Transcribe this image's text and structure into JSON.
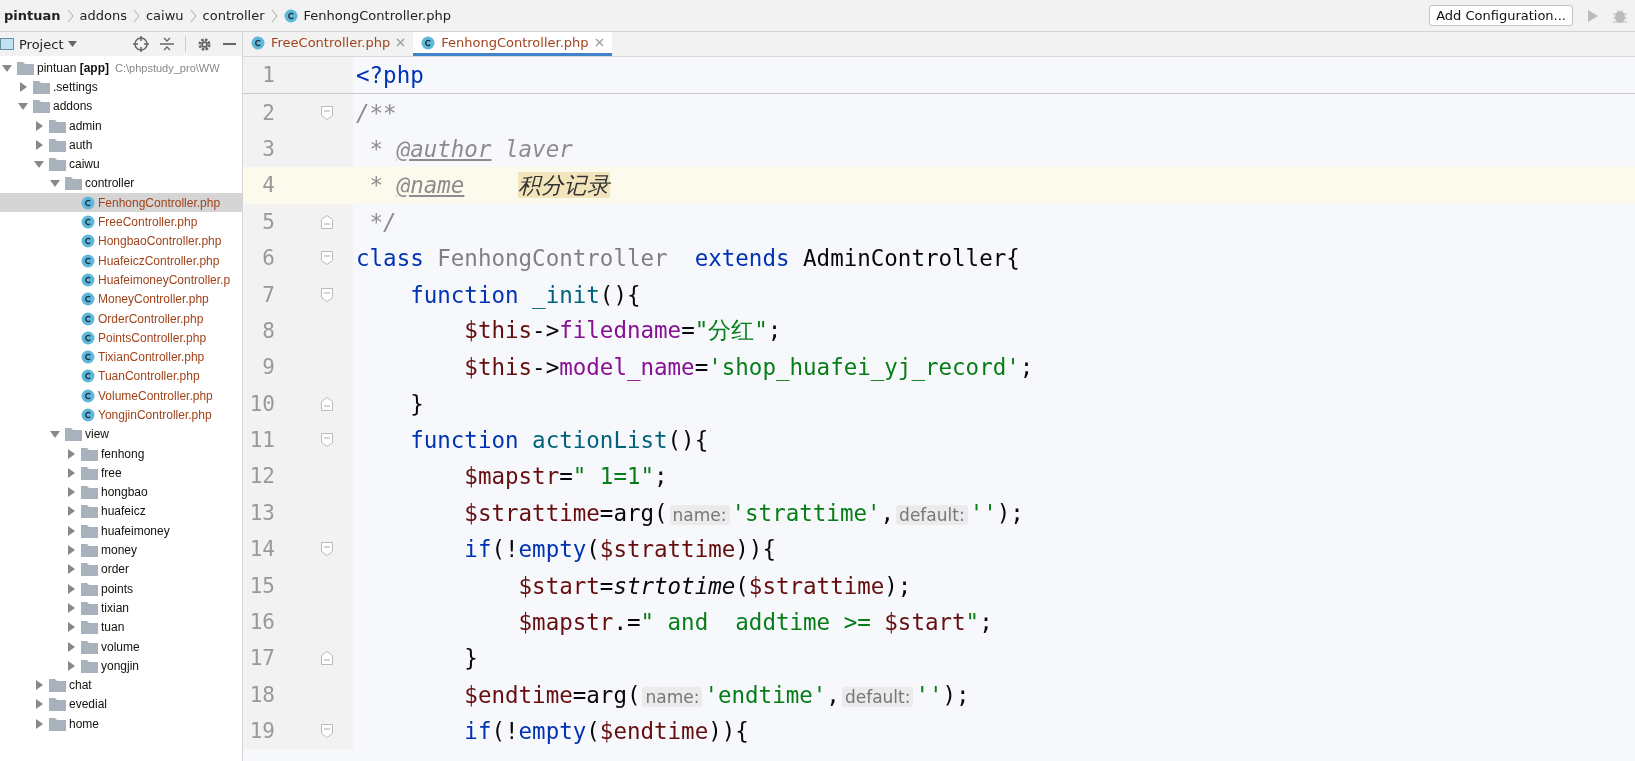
{
  "breadcrumbs": [
    {
      "label": "pintuan",
      "kind": "root"
    },
    {
      "label": "addons",
      "kind": "folder"
    },
    {
      "label": "caiwu",
      "kind": "folder"
    },
    {
      "label": "controller",
      "kind": "folder"
    },
    {
      "label": "FenhongController.php",
      "kind": "php"
    }
  ],
  "run_config": {
    "label": "Add Configuration..."
  },
  "project_panel": {
    "title": "Project"
  },
  "tree": [
    {
      "label": "pintuan **[app]**",
      "path": "C:\\phpstudy_pro\\WW",
      "kind": "folder",
      "expanded": true,
      "selected": false,
      "children": [
        {
          "label": ".settings",
          "kind": "folder",
          "expanded": false,
          "selected": false
        },
        {
          "label": "addons",
          "kind": "folder",
          "expanded": true,
          "selected": false,
          "children": [
            {
              "label": "admin",
              "kind": "folder",
              "expanded": false,
              "selected": false
            },
            {
              "label": "auth",
              "kind": "folder",
              "expanded": false,
              "selected": false
            },
            {
              "label": "caiwu",
              "kind": "folder",
              "expanded": true,
              "selected": false,
              "children": [
                {
                  "label": "controller",
                  "kind": "folder",
                  "expanded": true,
                  "selected": false,
                  "children": [
                    {
                      "label": "FenhongController.php",
                      "kind": "php",
                      "selected": true
                    },
                    {
                      "label": "FreeController.php",
                      "kind": "php",
                      "selected": false
                    },
                    {
                      "label": "HongbaoController.php",
                      "kind": "php",
                      "selected": false
                    },
                    {
                      "label": "HuafeiczController.php",
                      "kind": "php",
                      "selected": false
                    },
                    {
                      "label": "HuafeimoneyController.p",
                      "kind": "php",
                      "selected": false
                    },
                    {
                      "label": "MoneyController.php",
                      "kind": "php",
                      "selected": false
                    },
                    {
                      "label": "OrderController.php",
                      "kind": "php",
                      "selected": false
                    },
                    {
                      "label": "PointsController.php",
                      "kind": "php",
                      "selected": false
                    },
                    {
                      "label": "TixianController.php",
                      "kind": "php",
                      "selected": false
                    },
                    {
                      "label": "TuanController.php",
                      "kind": "php",
                      "selected": false
                    },
                    {
                      "label": "VolumeController.php",
                      "kind": "php",
                      "selected": false
                    },
                    {
                      "label": "YongjinController.php",
                      "kind": "php",
                      "selected": false
                    }
                  ]
                },
                {
                  "label": "view",
                  "kind": "folder",
                  "expanded": true,
                  "selected": false,
                  "children": [
                    {
                      "label": "fenhong",
                      "kind": "folder",
                      "expanded": false,
                      "selected": false
                    },
                    {
                      "label": "free",
                      "kind": "folder",
                      "expanded": false,
                      "selected": false
                    },
                    {
                      "label": "hongbao",
                      "kind": "folder",
                      "expanded": false,
                      "selected": false
                    },
                    {
                      "label": "huafeicz",
                      "kind": "folder",
                      "expanded": false,
                      "selected": false
                    },
                    {
                      "label": "huafeimoney",
                      "kind": "folder",
                      "expanded": false,
                      "selected": false
                    },
                    {
                      "label": "money",
                      "kind": "folder",
                      "expanded": false,
                      "selected": false
                    },
                    {
                      "label": "order",
                      "kind": "folder",
                      "expanded": false,
                      "selected": false
                    },
                    {
                      "label": "points",
                      "kind": "folder",
                      "expanded": false,
                      "selected": false
                    },
                    {
                      "label": "tixian",
                      "kind": "folder",
                      "expanded": false,
                      "selected": false
                    },
                    {
                      "label": "tuan",
                      "kind": "folder",
                      "expanded": false,
                      "selected": false
                    },
                    {
                      "label": "volume",
                      "kind": "folder",
                      "expanded": false,
                      "selected": false
                    },
                    {
                      "label": "yongjin",
                      "kind": "folder",
                      "expanded": false,
                      "selected": false
                    }
                  ]
                }
              ]
            },
            {
              "label": "chat",
              "kind": "folder",
              "expanded": false,
              "selected": false
            },
            {
              "label": "evedial",
              "kind": "folder",
              "expanded": false,
              "selected": false
            },
            {
              "label": "home",
              "kind": "folder",
              "expanded": false,
              "selected": false
            }
          ]
        }
      ]
    }
  ],
  "tabs": [
    {
      "label": "FreeController.php",
      "selected": false
    },
    {
      "label": "FenhongController.php",
      "selected": true
    }
  ],
  "code": [
    {
      "number": "1",
      "current": false,
      "kind": "plain",
      "tokens": [
        {
          "kind": "kw",
          "text": "<?php"
        }
      ]
    },
    {
      "number": "2",
      "current": false,
      "kind": "fold-start",
      "tokens": [
        {
          "kind": "comment",
          "text": "/**"
        }
      ]
    },
    {
      "number": "3",
      "current": false,
      "kind": "plain",
      "tokens": [
        {
          "kind": "comment",
          "text": " * "
        },
        {
          "kind": "doctag",
          "text": "@author"
        },
        {
          "kind": "comment",
          "text": " laver"
        }
      ]
    },
    {
      "number": "4",
      "current": true,
      "kind": "plain",
      "tokens": [
        {
          "kind": "comment",
          "text": " * "
        },
        {
          "kind": "doctag",
          "text": "@name"
        },
        {
          "kind": "match",
          "text": "积分记录"
        }
      ]
    },
    {
      "number": "5",
      "current": false,
      "kind": "fold-end",
      "tokens": [
        {
          "kind": "comment",
          "text": " */"
        }
      ]
    },
    {
      "number": "6",
      "current": false,
      "kind": "fold-start",
      "tokens": [
        {
          "kind": "kw",
          "text": "class "
        },
        {
          "kind": "unused",
          "text": "FenhongController"
        },
        {
          "kind": "kw",
          "text": "  extends "
        },
        {
          "kind": "plain",
          "text": "AdminController{"
        }
      ]
    },
    {
      "number": "7",
      "current": false,
      "kind": "fold-start",
      "tokens": [
        {
          "kind": "kw",
          "text": "    function "
        },
        {
          "kind": "fn",
          "text": "_init"
        },
        {
          "kind": "plain",
          "text": "(){"
        }
      ]
    },
    {
      "number": "8",
      "current": false,
      "kind": "plain",
      "tokens": [
        {
          "kind": "var",
          "text": "        $this"
        },
        {
          "kind": "plain",
          "text": "->"
        },
        {
          "kind": "prop",
          "text": "filedname"
        },
        {
          "kind": "plain",
          "text": "="
        },
        {
          "kind": "str",
          "text": "\"分红\""
        },
        {
          "kind": "plain",
          "text": ";"
        }
      ]
    },
    {
      "number": "9",
      "current": false,
      "kind": "plain",
      "tokens": [
        {
          "kind": "var",
          "text": "        $this"
        },
        {
          "kind": "plain",
          "text": "->"
        },
        {
          "kind": "prop",
          "text": "model_name"
        },
        {
          "kind": "plain",
          "text": "="
        },
        {
          "kind": "str",
          "text": "'shop_huafei_yj_record'"
        },
        {
          "kind": "plain",
          "text": ";"
        }
      ]
    },
    {
      "number": "10",
      "current": false,
      "kind": "fold-end",
      "tokens": [
        {
          "kind": "plain",
          "text": "    }"
        }
      ]
    },
    {
      "number": "11",
      "current": false,
      "kind": "fold-start",
      "tokens": [
        {
          "kind": "kw",
          "text": "    function "
        },
        {
          "kind": "fn",
          "text": "actionList"
        },
        {
          "kind": "plain",
          "text": "(){"
        }
      ]
    },
    {
      "number": "12",
      "current": false,
      "kind": "plain",
      "tokens": [
        {
          "kind": "var",
          "text": "        $mapstr"
        },
        {
          "kind": "plain",
          "text": "="
        },
        {
          "kind": "str",
          "text": "\" 1=1\""
        },
        {
          "kind": "plain",
          "text": ";"
        }
      ]
    },
    {
      "number": "13",
      "current": false,
      "kind": "plain",
      "tokens": [
        {
          "kind": "var",
          "text": "        $strattime"
        },
        {
          "kind": "plain",
          "text": "=arg("
        },
        {
          "kind": "hint",
          "text": "name:"
        },
        {
          "kind": "str",
          "text": "'strattime'"
        },
        {
          "kind": "plain",
          "text": ","
        },
        {
          "kind": "hint",
          "text": "default:"
        },
        {
          "kind": "str",
          "text": "''"
        },
        {
          "kind": "plain",
          "text": ");"
        }
      ]
    },
    {
      "number": "14",
      "current": false,
      "kind": "fold-start",
      "tokens": [
        {
          "kind": "kw",
          "text": "        if"
        },
        {
          "kind": "plain",
          "text": "(!"
        },
        {
          "kind": "kw",
          "text": "empty"
        },
        {
          "kind": "plain",
          "text": "("
        },
        {
          "kind": "var",
          "text": "$strattime"
        },
        {
          "kind": "plain",
          "text": ")){"
        }
      ]
    },
    {
      "number": "15",
      "current": false,
      "kind": "plain",
      "tokens": [
        {
          "kind": "var",
          "text": "            $start"
        },
        {
          "kind": "plain",
          "text": "="
        },
        {
          "kind": "call",
          "text": "strtotime"
        },
        {
          "kind": "plain",
          "text": "("
        },
        {
          "kind": "var",
          "text": "$strattime"
        },
        {
          "kind": "plain",
          "text": ");"
        }
      ]
    },
    {
      "number": "16",
      "current": false,
      "kind": "plain",
      "tokens": [
        {
          "kind": "var",
          "text": "            $mapstr"
        },
        {
          "kind": "plain",
          "text": ".="
        },
        {
          "kind": "str",
          "text": "\" and  addtime >= "
        },
        {
          "kind": "var",
          "text": "$start"
        },
        {
          "kind": "str",
          "text": "\""
        },
        {
          "kind": "plain",
          "text": ";"
        }
      ]
    },
    {
      "number": "17",
      "current": false,
      "kind": "fold-end",
      "tokens": [
        {
          "kind": "plain",
          "text": "        }"
        }
      ]
    },
    {
      "number": "18",
      "current": false,
      "kind": "plain",
      "tokens": [
        {
          "kind": "var",
          "text": "        $endtime"
        },
        {
          "kind": "plain",
          "text": "=arg("
        },
        {
          "kind": "hint",
          "text": "name:"
        },
        {
          "kind": "str",
          "text": "'endtime'"
        },
        {
          "kind": "plain",
          "text": ","
        },
        {
          "kind": "hint",
          "text": "default:"
        },
        {
          "kind": "str",
          "text": "''"
        },
        {
          "kind": "plain",
          "text": ");"
        }
      ]
    },
    {
      "number": "19",
      "current": false,
      "kind": "fold-start",
      "tokens": [
        {
          "kind": "kw",
          "text": "        if"
        },
        {
          "kind": "plain",
          "text": "(!"
        },
        {
          "kind": "kw",
          "text": "empty"
        },
        {
          "kind": "plain",
          "text": "("
        },
        {
          "kind": "var",
          "text": "$endtime"
        },
        {
          "kind": "plain",
          "text": ")){"
        }
      ]
    }
  ]
}
